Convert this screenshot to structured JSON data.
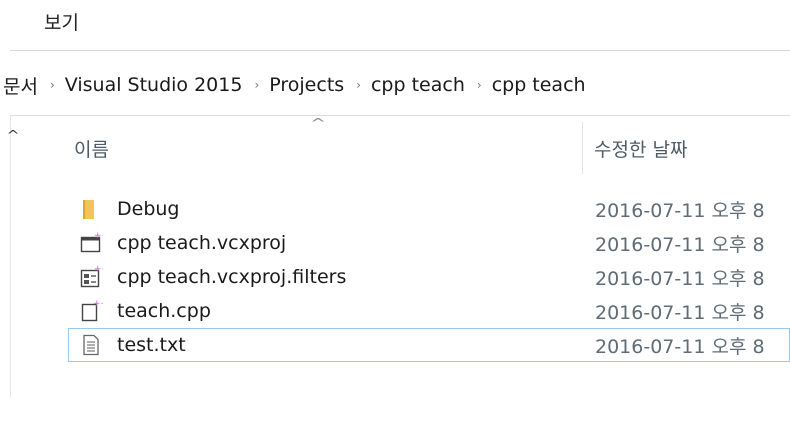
{
  "ribbon": {
    "view_tab": "보기"
  },
  "breadcrumb": {
    "items": [
      "문서",
      "Visual Studio 2015",
      "Projects",
      "cpp teach",
      "cpp teach"
    ],
    "separator": "›"
  },
  "columns": {
    "name": "이름",
    "date_modified": "수정한 날짜",
    "sort_indicator": "^",
    "nav_up": "^"
  },
  "files": [
    {
      "name": "Debug",
      "date": "2016-07-11 오후 8",
      "icon": "folder-icon"
    },
    {
      "name": "cpp teach.vcxproj",
      "date": "2016-07-11 오후 8",
      "icon": "vcxproj-file-icon"
    },
    {
      "name": "cpp teach.vcxproj.filters",
      "date": "2016-07-11 오후 8",
      "icon": "vcxproj-filters-file-icon"
    },
    {
      "name": "teach.cpp",
      "date": "2016-07-11 오후 8",
      "icon": "cpp-file-icon"
    },
    {
      "name": "test.txt",
      "date": "2016-07-11 오후 8",
      "icon": "text-file-icon"
    }
  ],
  "colors": {
    "focus_border": "#99c9ef",
    "folder": "#f2c45a",
    "vs_accent": "#c36ec9"
  }
}
